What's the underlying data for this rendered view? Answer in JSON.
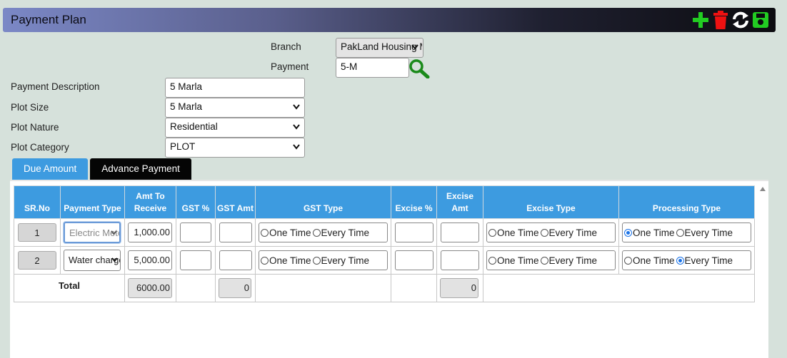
{
  "header": {
    "title": "Payment Plan",
    "icons": [
      "add-icon",
      "delete-icon",
      "refresh-icon",
      "save-icon"
    ],
    "colors": {
      "add": "#22cc22",
      "delete": "#ee1111",
      "refresh": "#ffffff",
      "save": "#22cc22"
    }
  },
  "form": {
    "branch_label": "Branch",
    "branch_value": "PakLand Housing M",
    "payment_label": "Payment",
    "payment_value": "5-M",
    "description_label": "Payment Description",
    "description_value": "5 Marla",
    "plot_size_label": "Plot Size",
    "plot_size_value": "5 Marla",
    "plot_nature_label": "Plot Nature",
    "plot_nature_value": "Residential",
    "plot_category_label": "Plot Category",
    "plot_category_value": "PLOT"
  },
  "tabs": [
    {
      "label": "Due Amount",
      "active": true
    },
    {
      "label": "Advance Payment",
      "active": false
    }
  ],
  "table": {
    "headers": {
      "srno": "SR.No",
      "payment_type": "Payment Type",
      "amt_to_receive": "Amt To Receive",
      "gst_pct": "GST %",
      "gst_amt": "GST Amt",
      "gst_type": "GST Type",
      "excise_pct": "Excise %",
      "excise_amt": "Excise Amt",
      "excise_type": "Excise Type",
      "processing_type": "Processing Type"
    },
    "radio_labels": {
      "one": "One Time",
      "every": "Every Time"
    },
    "rows": [
      {
        "sr": "1",
        "payment_type": "Electric Meter",
        "amount": "1,000.00",
        "gst_pct": "",
        "gst_amt": "",
        "gst_type": "",
        "excise_pct": "",
        "excise_amt": "",
        "excise_type": "",
        "processing_type": "One Time"
      },
      {
        "sr": "2",
        "payment_type": "Water charges",
        "amount": "5,000.00",
        "gst_pct": "",
        "gst_amt": "",
        "gst_type": "",
        "excise_pct": "",
        "excise_amt": "",
        "excise_type": "",
        "processing_type": "Every Time"
      }
    ],
    "totals": {
      "label": "Total",
      "amount": "6000.00",
      "gst_amt": "0",
      "excise_amt": "0"
    }
  }
}
